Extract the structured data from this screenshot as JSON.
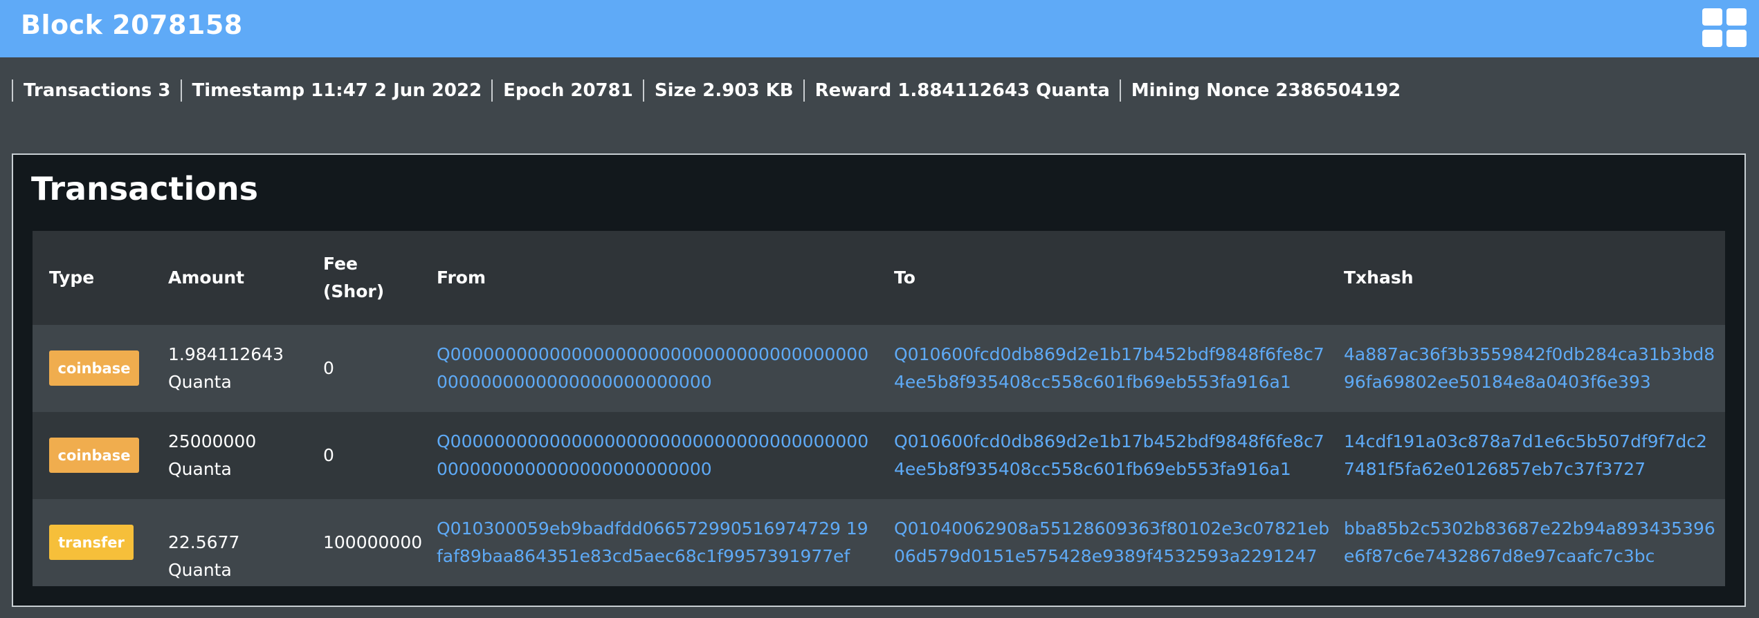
{
  "header": {
    "title": "Block 2078158",
    "menu_icon": "grid-icon",
    "background": "#5faaf7"
  },
  "meta": {
    "transactions": "Transactions 3",
    "timestamp": "Timestamp 11:47 2 Jun 2022",
    "epoch": "Epoch 20781",
    "size": "Size 2.903 KB",
    "reward": "Reward 1.884112643 Quanta",
    "mining_nonce": "Mining Nonce 2386504192"
  },
  "transactions": {
    "title": "Transactions",
    "columns": {
      "type": "Type",
      "amount": "Amount",
      "fee": "Fee (Shor)",
      "from": "From",
      "to": "To",
      "txhash": "Txhash"
    },
    "rows": [
      {
        "type": "coinbase",
        "type_color": "#f0ad4e",
        "amount": "1.984112643 Quanta",
        "fee": "0",
        "from": "Q000000000000000000000000000000000000000000000000000000000000000",
        "to": "Q010600fcd0db869d2e1b17b452bdf9848f6fe8c74ee5b8f935408cc558c601fb69eb553fa916a1",
        "txhash": "4a887ac36f3b3559842f0db284ca31b3bd896fa69802ee50184e8a0403f6e393"
      },
      {
        "type": "coinbase",
        "type_color": "#f0ad4e",
        "amount": "25000000 Quanta",
        "fee": "0",
        "from": "Q000000000000000000000000000000000000000000000000000000000000000",
        "to": "Q010600fcd0db869d2e1b17b452bdf9848f6fe8c74ee5b8f935408cc558c601fb69eb553fa916a1",
        "txhash": "14cdf191a03c878a7d1e6c5b507df9f7dc27481f5fa62e0126857eb7c37f3727"
      },
      {
        "type": "transfer",
        "type_color": "#f6bf3a",
        "amount": "22.5677 Quanta",
        "fee": "100000000",
        "from": "Q010300059eb9badfdd066572990516974729 19faf89baa864351e83cd5aec68c1f9957391977ef",
        "to": "Q01040062908a55128609363f80102e3c07821eb06d579d0151e575428e9389f4532593a2291247",
        "txhash": "bba85b2c5302b83687e22b94a893435396e6f87c6e7432867d8e97caafc7c3bc"
      }
    ]
  }
}
